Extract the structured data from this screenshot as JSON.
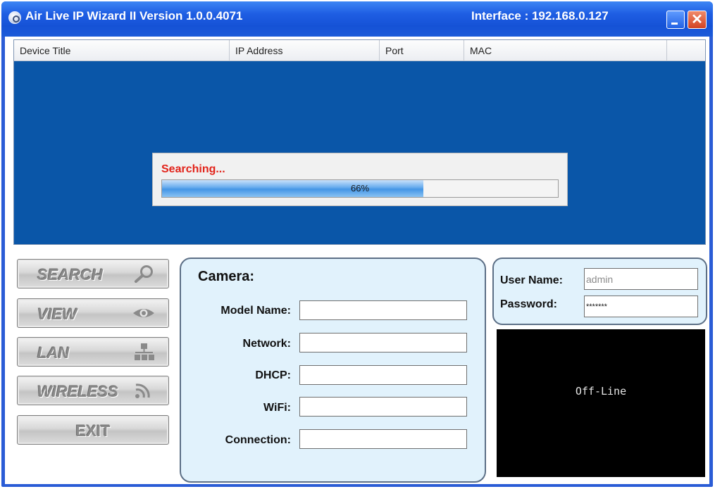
{
  "window": {
    "title": "Air Live IP Wizard II  Version 1.0.0.4071",
    "interface": "Interface : 192.168.0.127",
    "close_glyph": "✕",
    "icons": {
      "app": "camera-lens-icon",
      "minimize": "minimize-icon",
      "close": "close-icon"
    },
    "colors": {
      "titlebar": "#1f5ee3",
      "list_background": "#0a56a8",
      "panel_background": "#e1f2fc"
    }
  },
  "device_list": {
    "columns": [
      "Device Title",
      "IP Address",
      "Port",
      "MAC"
    ]
  },
  "progress": {
    "status_text": "Searching...",
    "percent": 66,
    "label": "66%",
    "color": "#e2231a"
  },
  "buttons": [
    {
      "label": "SEARCH",
      "icon": "magnifier-icon"
    },
    {
      "label": "VIEW",
      "icon": "eye-icon"
    },
    {
      "label": "LAN",
      "icon": "network-icon"
    },
    {
      "label": "WIRELESS",
      "icon": "wifi-signal-icon"
    },
    {
      "label": "EXIT",
      "icon": ""
    }
  ],
  "camera": {
    "title": "Camera:",
    "fields": [
      {
        "label": "Model Name:",
        "value": ""
      },
      {
        "label": "Network:",
        "value": ""
      },
      {
        "label": "DHCP:",
        "value": ""
      },
      {
        "label": "WiFi:",
        "value": ""
      },
      {
        "label": "Connection:",
        "value": ""
      }
    ]
  },
  "login": {
    "username_label": "User Name:",
    "username_value": "admin",
    "password_label": "Password:",
    "password_value": "*******"
  },
  "video": {
    "status": "Off-Line"
  }
}
